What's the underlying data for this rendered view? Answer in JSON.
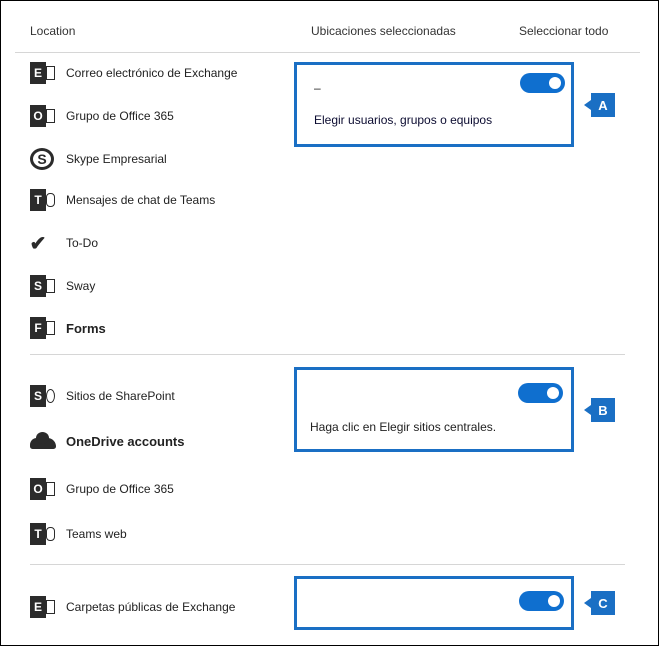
{
  "header": {
    "location": "Location",
    "selected": "Ubicaciones seleccionadas",
    "select_all": "Seleccionar todo"
  },
  "group_a": {
    "items": [
      {
        "label": "Correo electrónico de Exchange",
        "icon": "exchange-icon"
      },
      {
        "label": "Grupo de Office 365",
        "icon": "outlook-icon"
      },
      {
        "label": "Skype Empresarial",
        "icon": "skype-icon"
      },
      {
        "label": "Mensajes de chat de Teams",
        "icon": "teams-icon"
      },
      {
        "label": "To-Do",
        "icon": "todo-icon"
      },
      {
        "label": "Sway",
        "icon": "sway-icon"
      },
      {
        "label": "Forms",
        "icon": "forms-icon"
      }
    ],
    "dash": "–",
    "link": "Elegir usuarios, grupos o equipos",
    "callout": "A",
    "toggle_on": true
  },
  "group_b": {
    "items": [
      {
        "label": "Sitios de SharePoint",
        "icon": "sharepoint-icon"
      },
      {
        "label": "OneDrive accounts",
        "icon": "onedrive-icon"
      },
      {
        "label": "Grupo de Office 365",
        "icon": "outlook-icon"
      },
      {
        "label": "Teams web",
        "icon": "teams-icon"
      }
    ],
    "text": "Haga clic en Elegir sitios centrales.",
    "callout": "B",
    "toggle_on": true
  },
  "group_c": {
    "items": [
      {
        "label": "Carpetas públicas de Exchange",
        "icon": "exchange-icon"
      }
    ],
    "callout": "C",
    "toggle_on": true
  },
  "colors": {
    "accent": "#1a6fc4",
    "toggle": "#0f6fcf"
  }
}
